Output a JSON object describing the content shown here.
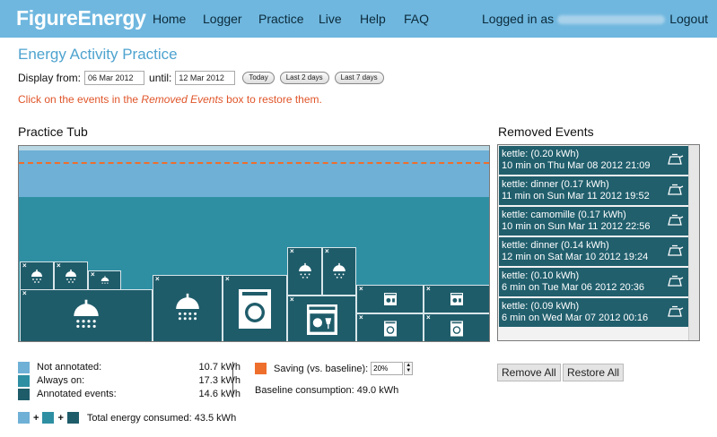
{
  "nav": {
    "logo": "FigureEnergy",
    "links": [
      "Home",
      "Logger",
      "Practice",
      "Live",
      "Help",
      "FAQ"
    ],
    "logged_in_prefix": "Logged in as",
    "logout": "Logout"
  },
  "page_title": "Energy Activity Practice",
  "date_range": {
    "display_from_label": "Display from:",
    "from_value": "06 Mar 2012",
    "until_label": "until:",
    "until_value": "12 Mar 2012",
    "btn_today": "Today",
    "btn_last2": "Last 2 days",
    "btn_last7": "Last 7 days"
  },
  "instruction": {
    "before": "Click on the events in the ",
    "emph": "Removed Events",
    "after": " box to restore them."
  },
  "tub": {
    "title": "Practice Tub",
    "events": [
      "shower",
      "shower",
      "shower",
      "shower",
      "shower",
      "shower",
      "shower",
      "washing-machine",
      "shower",
      "shower",
      "dishwasher",
      "microwave",
      "kettle",
      "washing-machine",
      "washing-machine"
    ]
  },
  "removed": {
    "title": "Removed Events",
    "items": [
      {
        "line1": "kettle: (0.20 kWh)",
        "line2": "10 min on Thu Mar 08 2012 21:09"
      },
      {
        "line1": "kettle: dinner (0.17 kWh)",
        "line2": "11 min on Sun Mar 11 2012 19:52"
      },
      {
        "line1": "kettle: camomille (0.17 kWh)",
        "line2": "10 min on Sun Mar 11 2012 22:56"
      },
      {
        "line1": "kettle: dinner (0.14 kWh)",
        "line2": "12 min on Sat Mar 10 2012 19:24"
      },
      {
        "line1": "kettle: (0.10 kWh)",
        "line2": "6 min on Tue Mar 06 2012 20:36"
      },
      {
        "line1": "kettle: (0.09 kWh)",
        "line2": "6 min on Wed Mar 07 2012 00:16"
      }
    ],
    "remove_all": "Remove All",
    "restore_all": "Restore All"
  },
  "legend": {
    "not_annotated": {
      "label": "Not annotated:",
      "value": "10.7 kWh"
    },
    "always_on": {
      "label": "Always on:",
      "value": "17.3 kWh"
    },
    "annotated": {
      "label": "Annotated events:",
      "value": "14.6 kWh"
    },
    "total_label": "Total energy consumed: 43.5 kWh"
  },
  "saving": {
    "label": "Saving (vs. baseline):",
    "value": "20%",
    "baseline_text": "Baseline consumption: 49.0 kWh"
  },
  "colors": {
    "nav_bg": "#6fb7df",
    "not_annotated": "#6fb0d6",
    "always_on": "#2e8fa3",
    "annotated": "#1f5c6a",
    "saving": "#ee6e2c",
    "baseline_dash": "#ee6e2c"
  }
}
